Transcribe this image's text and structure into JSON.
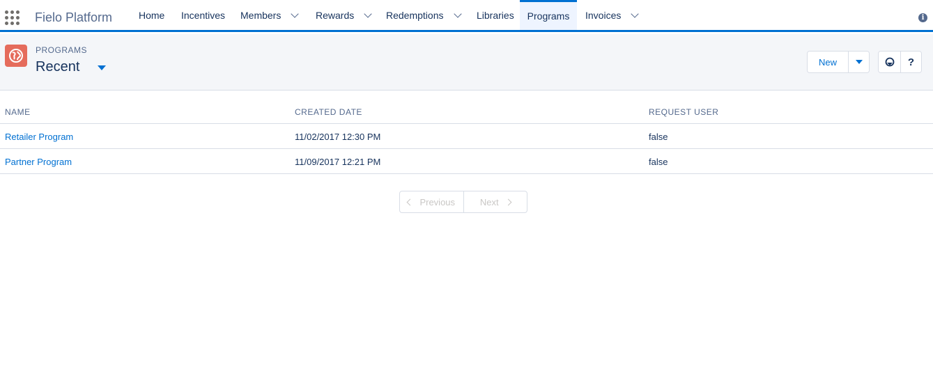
{
  "app": {
    "name": "Fielo Platform"
  },
  "nav": {
    "items": [
      {
        "label": "Home",
        "has_menu": false
      },
      {
        "label": "Incentives",
        "has_menu": false
      },
      {
        "label": "Members",
        "has_menu": true
      },
      {
        "label": "Rewards",
        "has_menu": true
      },
      {
        "label": "Redemptions",
        "has_menu": true
      },
      {
        "label": "Libraries",
        "has_menu": false
      },
      {
        "label": "Programs",
        "has_menu": false,
        "active": true
      },
      {
        "label": "Invoices",
        "has_menu": true
      }
    ]
  },
  "header": {
    "object_label": "PROGRAMS",
    "list_view": "Recent",
    "new_button": "New",
    "help_label": "?"
  },
  "table": {
    "columns": [
      "NAME",
      "CREATED DATE",
      "REQUEST USER"
    ],
    "rows": [
      {
        "name": "Retailer Program",
        "created_date": "11/02/2017 12:30 PM",
        "request_user": "false"
      },
      {
        "name": "Partner Program",
        "created_date": "11/09/2017 12:21 PM",
        "request_user": "false"
      }
    ]
  },
  "pager": {
    "previous": "Previous",
    "next": "Next"
  },
  "colors": {
    "brand": "#0070d2",
    "object_icon": "#e56c5c",
    "header_bg": "#f4f6f9",
    "active_tab_bg": "#eef4ff"
  },
  "icons": [
    "app-launcher-icon",
    "info-icon",
    "program-icon",
    "chevron-down-icon",
    "help-icon"
  ]
}
